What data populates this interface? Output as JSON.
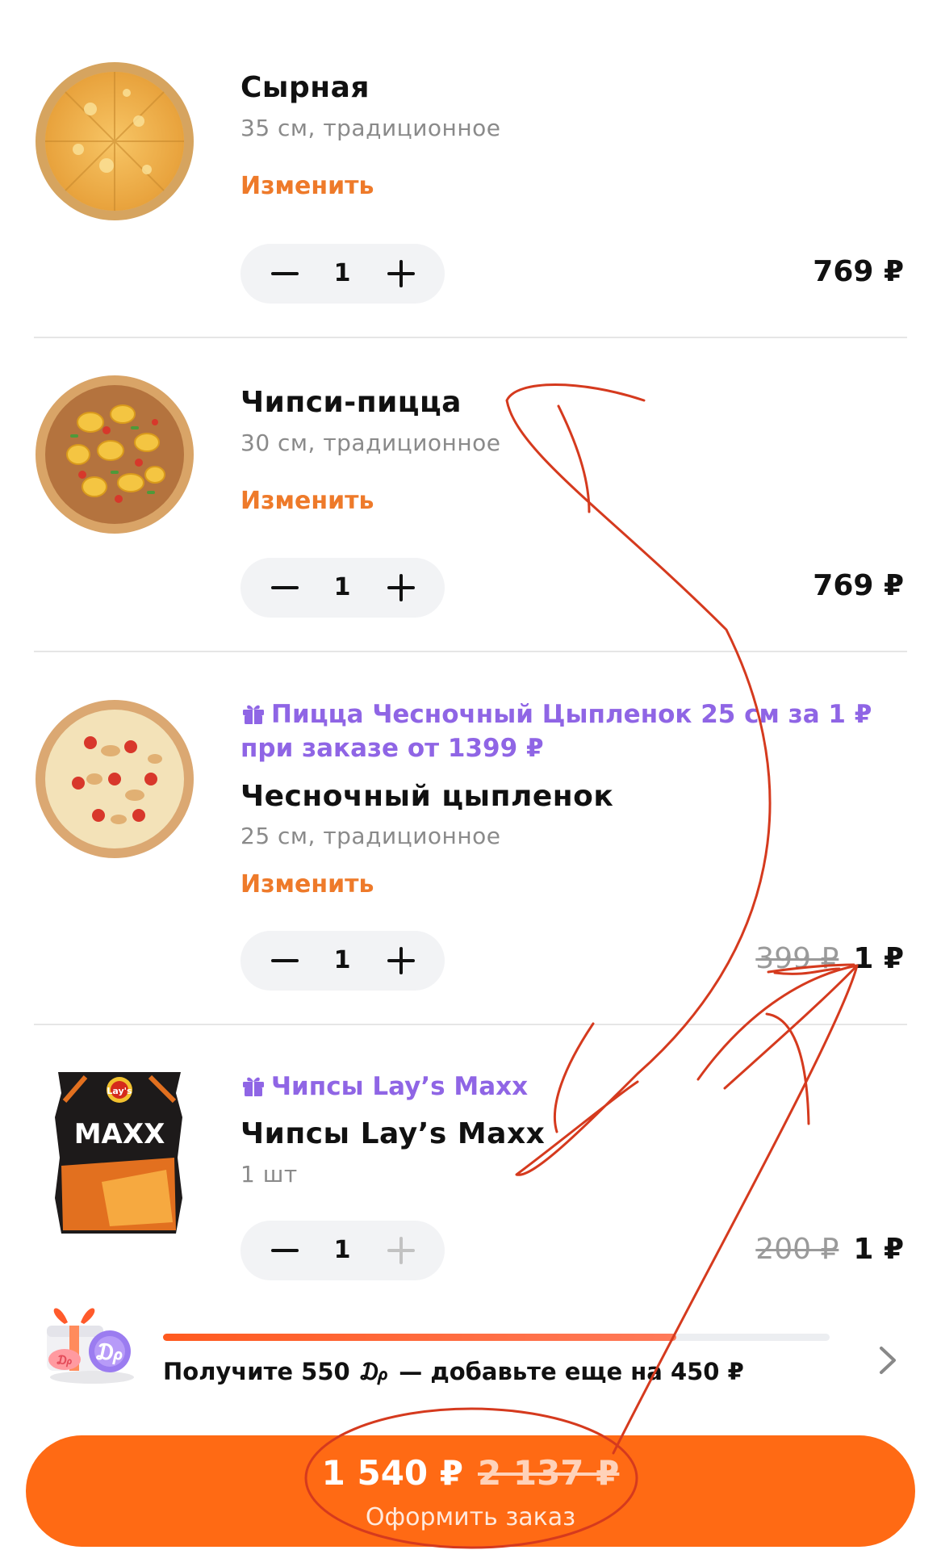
{
  "colors": {
    "accent": "#ff6a14",
    "change_link": "#ee7a2a",
    "promo": "#8f65e5",
    "annotation": "#d53a1e"
  },
  "cart": {
    "items": [
      {
        "title": "Сырная",
        "subtitle": "35  см, традиционное",
        "change_label": "Изменить",
        "qty": "1",
        "price": "769 ₽",
        "image": "cheese-pizza"
      },
      {
        "title": "Чипси-пицца",
        "subtitle": "30  см, традиционное",
        "change_label": "Изменить",
        "qty": "1",
        "price": "769 ₽",
        "image": "chips-pizza"
      },
      {
        "promo": "Пицца Чесночный Цыпленок 25 см за 1 ₽ при заказе от 1399 ₽",
        "promo_icon": "gift-icon",
        "title": "Чесночный цыпленок",
        "subtitle": "25  см, традиционное",
        "change_label": "Изменить",
        "qty": "1",
        "old_price": "399 ₽",
        "price": "1 ₽",
        "image": "garlic-chicken-pizza"
      },
      {
        "promo": "Чипсы Lay’s Maxx",
        "promo_icon": "gift-icon",
        "title": "Чипсы Lay’s Maxx",
        "subtitle": "1  шт",
        "qty": "1",
        "old_price": "200 ₽",
        "price": "1 ₽",
        "image": "lays-maxx-pack",
        "pack_brand": "Lay's",
        "pack_name": "MAXX"
      }
    ]
  },
  "bonus": {
    "text": "Получите 550 ₯ — добавьте еще на 450 ₽",
    "progress": 0.77,
    "icon": "gift-box-dodocoin-icon",
    "chevron_icon": "chevron-right-icon"
  },
  "checkout": {
    "total": "1 540 ₽",
    "old_total": "2 137 ₽",
    "label": "Оформить заказ"
  }
}
